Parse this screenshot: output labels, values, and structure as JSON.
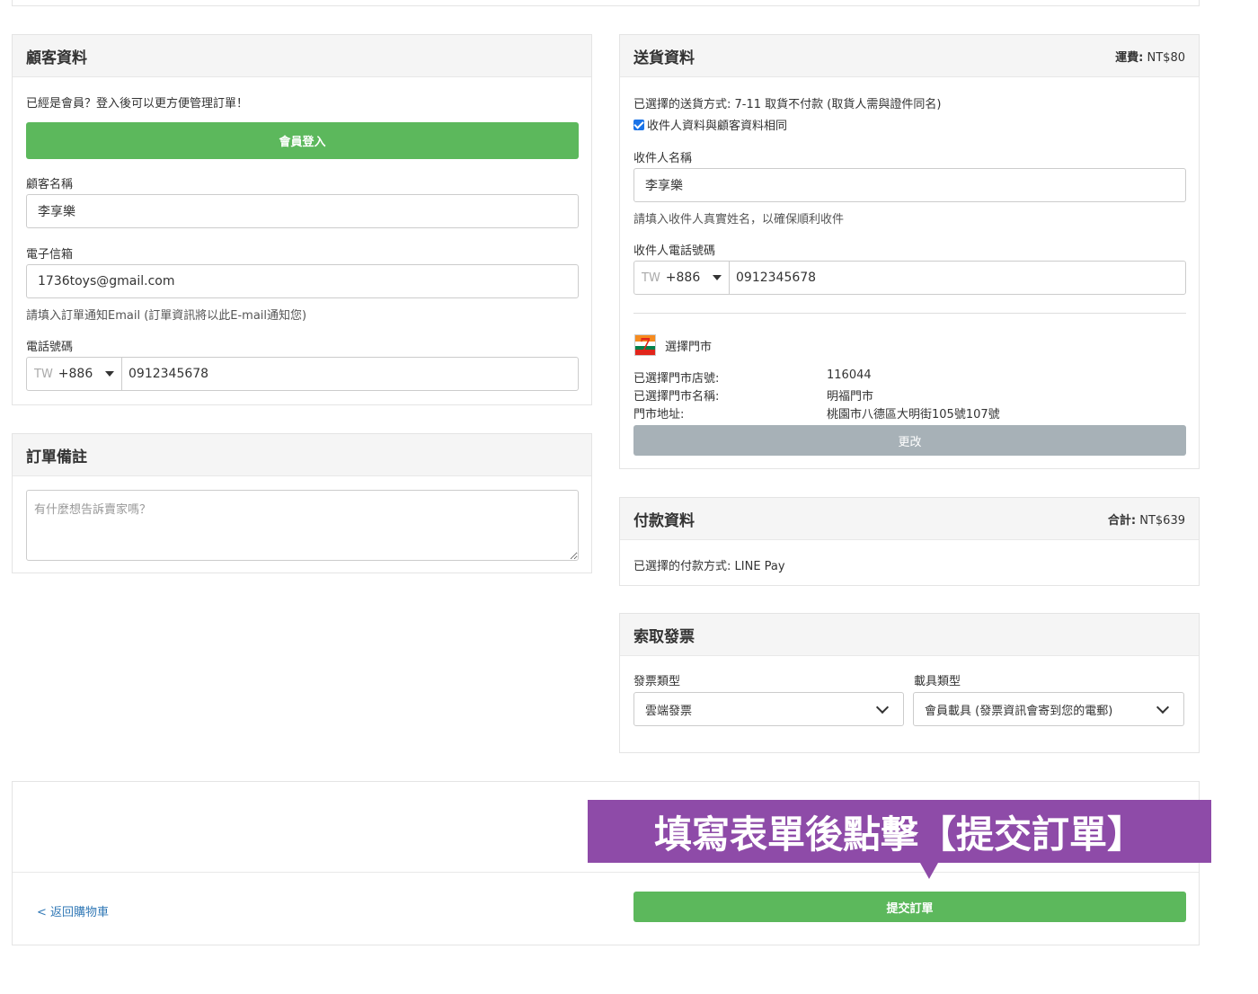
{
  "customer": {
    "title": "顧客資料",
    "member_prompt": "已經是會員？登入後可以更方便管理訂單！",
    "login_button": "會員登入",
    "name_label": "顧客名稱",
    "name_value": "李享樂",
    "email_label": "電子信箱",
    "email_value": "1736toys@gmail.com",
    "email_help": "請填入訂單通知Email (訂單資訊將以此E-mail通知您)",
    "phone_label": "電話號碼",
    "phone_country": "TW",
    "phone_code": "+886",
    "phone_value": "0912345678"
  },
  "note": {
    "title": "訂單備註",
    "placeholder": "有什麼想告訴賣家嗎？"
  },
  "delivery": {
    "title": "送貨資料",
    "fee_label": "運費:",
    "fee_value": "NT$80",
    "method_text": "已選擇的送貨方式: 7-11 取貨不付款 (取貨人需與證件同名)",
    "same_as_customer": "收件人資料與顧客資料相同",
    "recipient_name_label": "收件人名稱",
    "recipient_name_value": "李享樂",
    "recipient_name_help": "請填入收件人真實姓名，以確保順利收件",
    "recipient_phone_label": "收件人電話號碼",
    "recipient_phone_country": "TW",
    "recipient_phone_code": "+886",
    "recipient_phone_value": "0912345678",
    "store_select_label": "選擇門市",
    "store_id_label": "已選擇門市店號:",
    "store_id_value": "116044",
    "store_name_label": "已選擇門市名稱:",
    "store_name_value": "明福門市",
    "store_address_label": "門市地址:",
    "store_address_value": "桃園市八德區大明街105號107號",
    "change_button": "更改"
  },
  "payment": {
    "title": "付款資料",
    "total_label": "合計:",
    "total_value": "NT$639",
    "method_text": "已選擇的付款方式: LINE Pay"
  },
  "invoice": {
    "title": "索取發票",
    "type_label": "發票類型",
    "type_value": "雲端發票",
    "carrier_label": "載具類型",
    "carrier_value": "會員載具 (發票資訊會寄到您的電郵)"
  },
  "footer": {
    "back_link": "< 返回購物車",
    "submit_button": "提交訂單",
    "banner_text": "填寫表單後點擊【提交訂單】"
  }
}
